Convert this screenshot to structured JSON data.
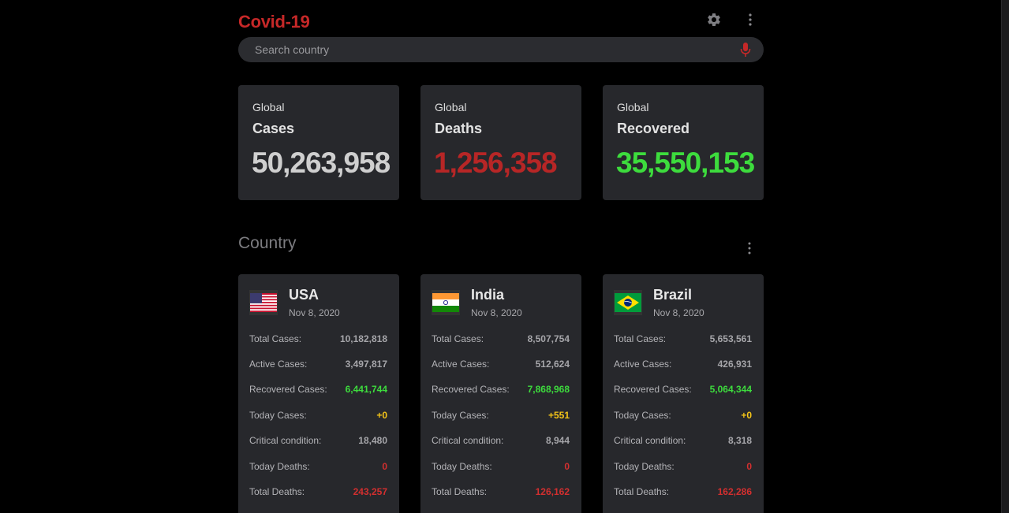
{
  "header": {
    "title": "Covid-19"
  },
  "search": {
    "placeholder": "Search country"
  },
  "global": [
    {
      "label": "Global",
      "title": "Cases",
      "value": "50,263,958",
      "color": "#cfcfcf"
    },
    {
      "label": "Global",
      "title": "Deaths",
      "value": "1,256,358",
      "color": "#b72626"
    },
    {
      "label": "Global",
      "title": "Recovered",
      "value": "35,550,153",
      "color": "#3ddc3d"
    }
  ],
  "section": {
    "title": "Country"
  },
  "countries": [
    {
      "name": "USA",
      "date": "Nov 8, 2020",
      "flag": "usa-flag-icon",
      "stats": [
        {
          "label": "Total Cases:",
          "value": "10,182,818"
        },
        {
          "label": "Active Cases:",
          "value": "3,497,817"
        },
        {
          "label": "Recovered Cases:",
          "value": "6,441,744"
        },
        {
          "label": "Today Cases:",
          "value": "+0"
        },
        {
          "label": "Critical condition:",
          "value": "18,480"
        },
        {
          "label": "Today Deaths:",
          "value": "0"
        },
        {
          "label": "Total Deaths:",
          "value": "243,257"
        }
      ]
    },
    {
      "name": "India",
      "date": "Nov 8, 2020",
      "flag": "india-flag-icon",
      "stats": [
        {
          "label": "Total Cases:",
          "value": "8,507,754"
        },
        {
          "label": "Active Cases:",
          "value": "512,624"
        },
        {
          "label": "Recovered Cases:",
          "value": "7,868,968"
        },
        {
          "label": "Today Cases:",
          "value": "+551"
        },
        {
          "label": "Critical condition:",
          "value": "8,944"
        },
        {
          "label": "Today Deaths:",
          "value": "0"
        },
        {
          "label": "Total Deaths:",
          "value": "126,162"
        }
      ]
    },
    {
      "name": "Brazil",
      "date": "Nov 8, 2020",
      "flag": "brazil-flag-icon",
      "stats": [
        {
          "label": "Total Cases:",
          "value": "5,653,561"
        },
        {
          "label": "Active Cases:",
          "value": "426,931"
        },
        {
          "label": "Recovered Cases:",
          "value": "5,064,344"
        },
        {
          "label": "Today Cases:",
          "value": "+0"
        },
        {
          "label": "Critical condition:",
          "value": "8,318"
        },
        {
          "label": "Today Deaths:",
          "value": "0"
        },
        {
          "label": "Total Deaths:",
          "value": "162,286"
        }
      ]
    }
  ],
  "icons": {
    "settings": "gear-icon",
    "more": "more-vert-icon",
    "mic": "microphone-icon"
  },
  "colors": {
    "brand": "#c62828",
    "green": "#3ddc3d",
    "yellow": "#f5c518",
    "red": "#d32f2f",
    "card": "#27282c",
    "search": "#2b2c30"
  }
}
